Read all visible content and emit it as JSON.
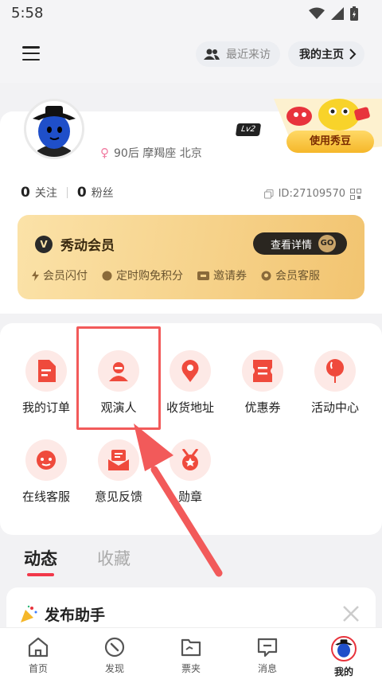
{
  "status_bar": {
    "time": "5:58"
  },
  "header": {
    "recent_visitors_label": "最近来访",
    "my_homepage_label": "我的主页"
  },
  "profile": {
    "gender_symbol": "♀",
    "meta": "90后 摩羯座 北京",
    "level": "Lv2",
    "bean_button": "使用秀豆",
    "following_count": "0",
    "following_label": "关注",
    "fans_count": "0",
    "fans_label": "粉丝",
    "user_id": "ID:27109570"
  },
  "vip": {
    "title": "秀动会员",
    "detail_button": "查看详情",
    "go": "GO",
    "benefits": [
      "会员闪付",
      "定时购免积分",
      "邀请券",
      "会员客服"
    ]
  },
  "services": [
    {
      "label": "我的订单",
      "icon": "order-icon"
    },
    {
      "label": "观演人",
      "icon": "person-icon"
    },
    {
      "label": "收货地址",
      "icon": "location-icon"
    },
    {
      "label": "优惠券",
      "icon": "coupon-icon"
    },
    {
      "label": "活动中心",
      "icon": "balloon-icon"
    },
    {
      "label": "在线客服",
      "icon": "headset-icon"
    },
    {
      "label": "意见反馈",
      "icon": "feedback-icon"
    },
    {
      "label": "勋章",
      "icon": "medal-icon"
    }
  ],
  "tabs": {
    "active": "动态",
    "inactive": "收藏"
  },
  "publish": {
    "title": "发布助手"
  },
  "bottom_nav": [
    {
      "label": "首页",
      "icon": "home-icon"
    },
    {
      "label": "发现",
      "icon": "compass-icon"
    },
    {
      "label": "票夹",
      "icon": "ticket-folder-icon"
    },
    {
      "label": "消息",
      "icon": "message-icon"
    },
    {
      "label": "我的",
      "icon": "avatar-icon"
    }
  ],
  "colors": {
    "accent": "#f2384a",
    "highlight": "#f25a5a",
    "icon_bg": "#fde9e6",
    "icon_fg": "#ef4a3c"
  }
}
